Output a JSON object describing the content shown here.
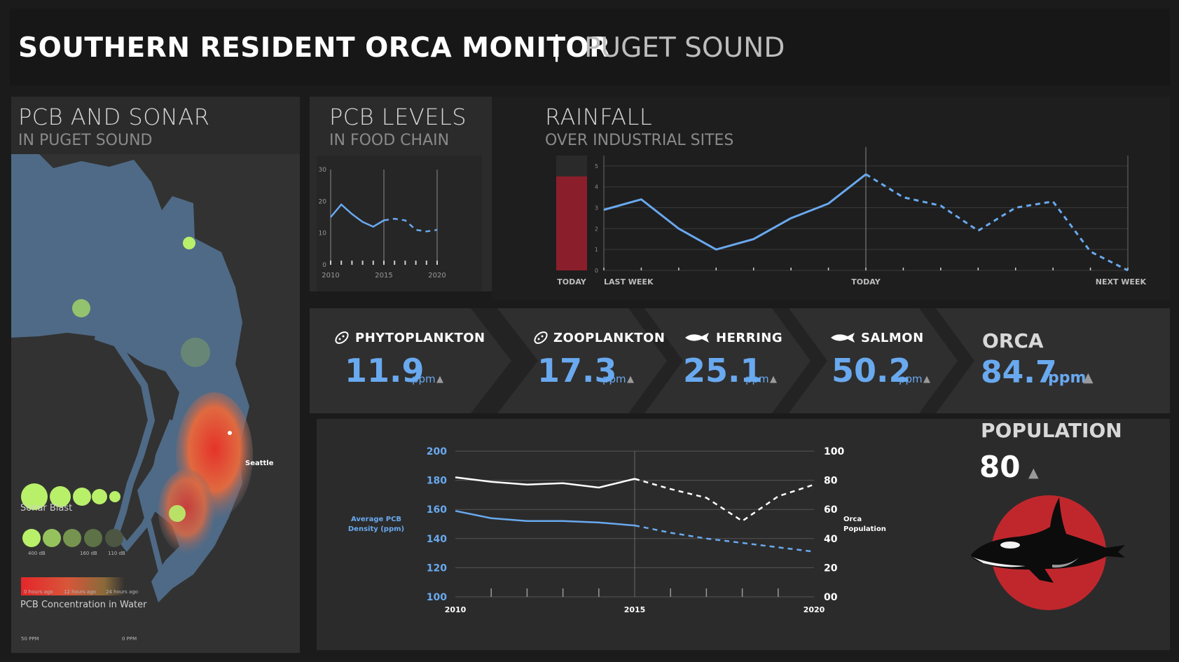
{
  "header": {
    "title": "SOUTHERN RESIDENT ORCA MONITOR",
    "separator": "|",
    "subtitle": "PUGET SOUND"
  },
  "map_panel": {
    "title": "PCB AND SONAR",
    "subtitle": "IN PUGET SOUND",
    "city_label": "Seattle",
    "sonar_title": "Sonar Blast",
    "sonar_size_labels": [
      "400 dB",
      "160 dB",
      "110 dB"
    ],
    "sonar_time_labels": [
      "0 hours ago",
      "12 hours ago",
      "24 hours ago"
    ],
    "pcb_legend_title": "PCB Concentration in Water",
    "pcb_legend_labels": [
      "50 PPM",
      "0 PPM"
    ],
    "colors": {
      "water": "#4f6a86",
      "land": "#323232",
      "sonar": "#b8f06a",
      "pcb_high": "#e5332a"
    }
  },
  "pcb_panel": {
    "title": "PCB LEVELS",
    "subtitle": "IN FOOD CHAIN"
  },
  "rain_panel": {
    "title": "RAINFALL",
    "subtitle": "OVER INDUSTRIAL SITES",
    "today_label": "TODAY"
  },
  "food_chain": [
    {
      "label": "PHYTOPLANKTON",
      "value": "11.9",
      "unit": "ppm",
      "icon": "plankton-icon"
    },
    {
      "label": "ZOOPLANKTON",
      "value": "17.3",
      "unit": "ppm",
      "icon": "plankton-icon"
    },
    {
      "label": "HERRING",
      "value": "25.1",
      "unit": "ppm",
      "icon": "fish-icon"
    },
    {
      "label": "SALMON",
      "value": "50.2",
      "unit": "ppm",
      "icon": "fish-icon"
    }
  ],
  "orca": {
    "label": "ORCA",
    "value": "84.7",
    "unit": "ppm",
    "trend": "▲",
    "population_label": "POPULATION",
    "population_value": "80"
  },
  "trend_symbol": "▲",
  "colors": {
    "accent_blue": "#69a9ef",
    "rain_bar": "#8b1e2b",
    "orca_circle": "#c0272d"
  },
  "chart_data": [
    {
      "type": "line",
      "title": "PCB LEVELS",
      "subtitle": "IN FOOD CHAIN",
      "x": [
        2010,
        2011,
        2012,
        2013,
        2014,
        2015,
        2016,
        2017,
        2018,
        2019,
        2020
      ],
      "series": [
        {
          "values": [
            15,
            19,
            16,
            13.5,
            12,
            14,
            null,
            null,
            null,
            null,
            null
          ],
          "style": "solid"
        },
        {
          "values": [
            null,
            null,
            null,
            null,
            null,
            14,
            14.5,
            14,
            11,
            10.5,
            11
          ],
          "style": "dashed"
        }
      ],
      "xticks": [
        "2010",
        "2015",
        "2020"
      ],
      "yticks": [
        "0",
        "10",
        "20",
        "30"
      ],
      "ylim": [
        0,
        30
      ],
      "xlim": [
        2010,
        2020
      ],
      "today_x": 2015,
      "grid": false
    },
    {
      "type": "line",
      "title": "RAINFALL",
      "subtitle": "OVER INDUSTRIAL SITES",
      "x": [
        -7,
        -6,
        -5,
        -4,
        -3,
        -2,
        -1,
        0,
        1,
        2,
        3,
        4,
        5,
        6,
        7
      ],
      "series": [
        {
          "values": [
            2.9,
            3.4,
            2,
            1,
            1.5,
            2.5,
            3.2,
            4.6,
            null,
            null,
            null,
            null,
            null,
            null,
            null
          ],
          "style": "solid"
        },
        {
          "values": [
            null,
            null,
            null,
            null,
            null,
            null,
            null,
            4.6,
            3.5,
            3.1,
            1.9,
            3,
            3.3,
            0.9,
            0
          ],
          "style": "dashed"
        }
      ],
      "today_bar": {
        "label": "TODAY",
        "value": 4.5,
        "max": 5.5
      },
      "xticks": [
        "LAST WEEK",
        "TODAY",
        "NEXT WEEK"
      ],
      "xticks_at": [
        -7,
        0,
        7
      ],
      "yticks": [
        "0",
        "1",
        "2",
        "3",
        "4",
        "5"
      ],
      "ylim": [
        0,
        5.5
      ],
      "xlim": [
        -7,
        7
      ],
      "grid": true
    },
    {
      "type": "line",
      "x": [
        2010,
        2011,
        2012,
        2013,
        2014,
        2015,
        2016,
        2017,
        2018,
        2019,
        2020
      ],
      "left_axis": {
        "label": "Average PCB Density (ppm)",
        "ylim": [
          100,
          200
        ],
        "ticks": [
          "200",
          "180",
          "160",
          "140",
          "120",
          "100"
        ]
      },
      "right_axis": {
        "label": "Orca Population",
        "ylim": [
          0,
          100
        ],
        "ticks": [
          "100",
          "80",
          "60",
          "40",
          "20",
          "00"
        ]
      },
      "series": [
        {
          "name": "Average PCB Density (ppm)",
          "axis": "left",
          "values": [
            159,
            154,
            152,
            152,
            151,
            149,
            null,
            null,
            null,
            null,
            null
          ],
          "style": "solid"
        },
        {
          "name": "Average PCB Density (ppm)",
          "axis": "left",
          "values": [
            null,
            null,
            null,
            null,
            null,
            149,
            144,
            140,
            137,
            134,
            131
          ],
          "style": "dashed"
        },
        {
          "name": "Orca Population",
          "axis": "right",
          "values": [
            82,
            79,
            77,
            78,
            75,
            81,
            null,
            null,
            null,
            null,
            null
          ],
          "style": "solid"
        },
        {
          "name": "Orca Population",
          "axis": "right",
          "values": [
            null,
            null,
            null,
            null,
            null,
            81,
            74,
            68,
            52,
            69,
            77
          ],
          "style": "dashed"
        }
      ],
      "xticks": [
        "2010",
        "2015",
        "2020"
      ],
      "grid": true
    }
  ]
}
